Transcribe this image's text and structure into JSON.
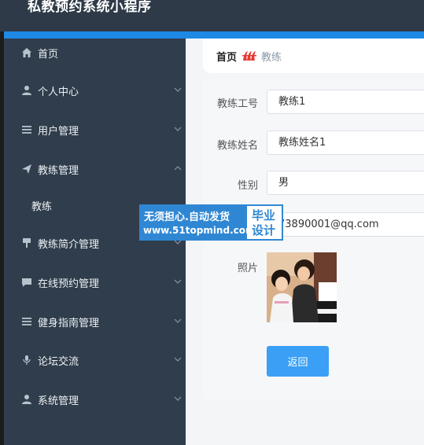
{
  "app": {
    "title": "私教预约系统小程序"
  },
  "colors": {
    "sidebar_bg": "#2f3d4c",
    "header_bg": "#2e3a48",
    "accent": "#1e88e5",
    "button": "#3a9ff5"
  },
  "sidebar": {
    "items": [
      {
        "label": "首页",
        "icon": "home-icon",
        "has_chevron": false
      },
      {
        "label": "个人中心",
        "icon": "user-icon",
        "has_chevron": true
      },
      {
        "label": "用户管理",
        "icon": "list-icon",
        "has_chevron": true
      },
      {
        "label": "教练管理",
        "icon": "send-icon",
        "has_chevron": true,
        "expanded": true
      },
      {
        "label": "教练",
        "submenu": true
      },
      {
        "label": "教练简介管理",
        "icon": "sign-icon",
        "has_chevron": true
      },
      {
        "label": "在线预约管理",
        "icon": "chat-icon",
        "has_chevron": true
      },
      {
        "label": "健身指南管理",
        "icon": "list-icon",
        "has_chevron": true
      },
      {
        "label": "论坛交流",
        "icon": "mic-icon",
        "has_chevron": true
      },
      {
        "label": "系统管理",
        "icon": "user-icon",
        "has_chevron": true
      }
    ]
  },
  "breadcrumb": {
    "home": "首页",
    "current": "教练",
    "separator_icon": "brand-logo-icon"
  },
  "form": {
    "coach_id_label": "教练工号",
    "coach_id_value": "教练1",
    "coach_name_label": "教练姓名",
    "coach_name_value": "教练姓名1",
    "gender_label": "性别",
    "gender_value": "男",
    "email_value": "73890001@qq.com",
    "photo_label": "照片",
    "back_label": "返回"
  },
  "watermark": {
    "line1": "无须担心.自动发货",
    "line2": "www.51topmind.com",
    "right1": "毕业",
    "right2": "设计"
  }
}
